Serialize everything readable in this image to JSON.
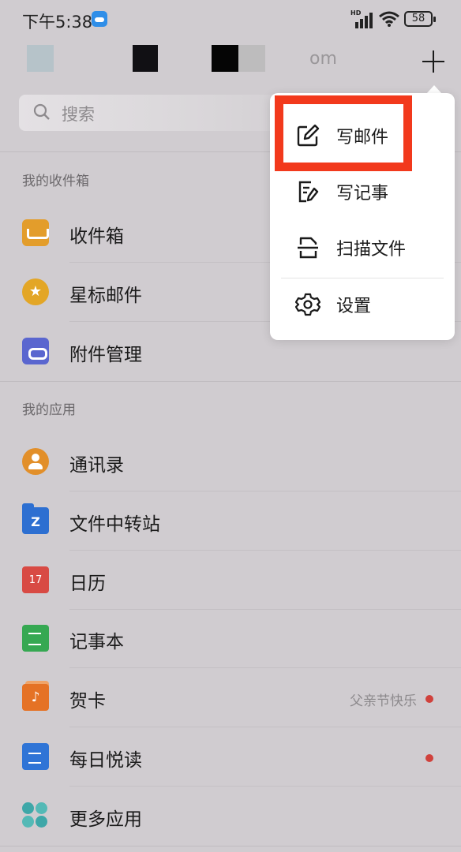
{
  "status_bar": {
    "time": "下午5:38",
    "battery": "58",
    "network": "HD"
  },
  "header": {
    "account_suffix": "om",
    "add_icon": "plus-icon"
  },
  "search": {
    "placeholder": "搜索"
  },
  "sections": {
    "mailbox_title": "我的收件箱",
    "apps_title": "我的应用"
  },
  "mailbox_items": [
    {
      "label": "收件箱",
      "icon": "inbox-icon"
    },
    {
      "label": "星标邮件",
      "icon": "star-icon"
    },
    {
      "label": "附件管理",
      "icon": "attachment-icon"
    }
  ],
  "app_items": [
    {
      "label": "通讯录",
      "icon": "contacts-icon"
    },
    {
      "label": "文件中转站",
      "icon": "folder-icon",
      "icon_text": "Z"
    },
    {
      "label": "日历",
      "icon": "calendar-icon",
      "icon_text": "17"
    },
    {
      "label": "记事本",
      "icon": "notebook-icon"
    },
    {
      "label": "贺卡",
      "icon": "greeting-card-icon",
      "badge_text": "父亲节快乐",
      "has_dot": true
    },
    {
      "label": "每日悦读",
      "icon": "daily-read-icon",
      "has_dot": true
    },
    {
      "label": "更多应用",
      "icon": "more-apps-icon"
    }
  ],
  "popup_menu": {
    "items": [
      {
        "label": "写邮件",
        "icon": "compose-icon"
      },
      {
        "label": "写记事",
        "icon": "write-note-icon"
      },
      {
        "label": "扫描文件",
        "icon": "scan-icon"
      },
      {
        "label": "设置",
        "icon": "gear-icon"
      }
    ]
  },
  "colors": {
    "background": "#d0ccd0",
    "highlight": "#f2391c",
    "red_dot": "#d0413c"
  }
}
